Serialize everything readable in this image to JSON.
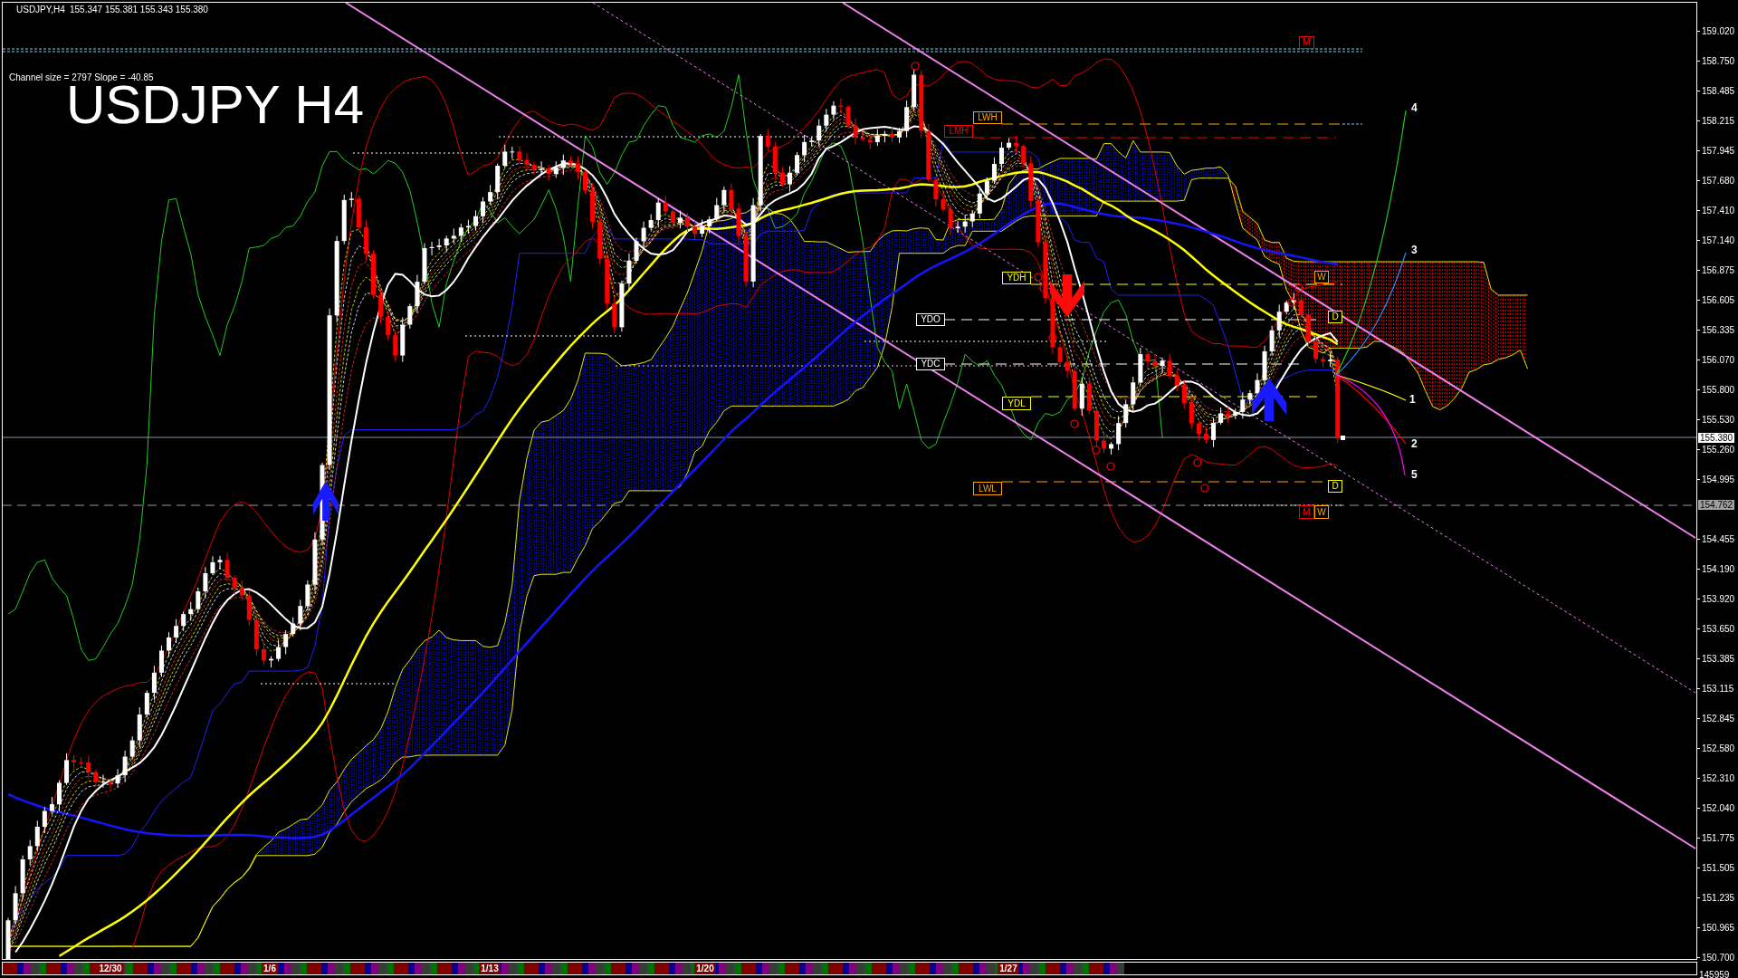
{
  "header": {
    "symbol": "USDJPY,H4",
    "ohlc": "155.347 155.381 155.343 155.380"
  },
  "channel_info": "Channel size = 2797 Slope = -40.85",
  "title": "USDJPY H4",
  "level_labels": [
    {
      "label": "M",
      "color": "#ff0000"
    },
    {
      "label": "LWH",
      "color": "#ffa500"
    },
    {
      "label": "LMH",
      "color": "#ff0000"
    },
    {
      "label": "YDH",
      "color": "#ffff00"
    },
    {
      "label": "W",
      "color": "#ffa500"
    },
    {
      "label": "YDO",
      "color": "#ffffff"
    },
    {
      "label": "D",
      "color": "#ffff00"
    },
    {
      "label": "YDC",
      "color": "#ffffff"
    },
    {
      "label": "YDL",
      "color": "#ffff00"
    },
    {
      "label": "LWL",
      "color": "#ffa500"
    },
    {
      "label": "D",
      "color": "#ffff00"
    },
    {
      "label": "M",
      "color": "#ff0000"
    },
    {
      "label": "W",
      "color": "#ffa500"
    }
  ],
  "projections": [
    {
      "label": "4",
      "color": "#22cc22"
    },
    {
      "label": "3",
      "color": "#1e90ff"
    },
    {
      "label": "1",
      "color": "#ffff00"
    },
    {
      "label": "2",
      "color": "#ff0000"
    },
    {
      "label": "5",
      "color": "#ff00ff"
    }
  ],
  "price_axis": {
    "ticks": [
      {
        "text": "159.020",
        "kind": "tick"
      },
      {
        "text": "158.750",
        "kind": "tick"
      },
      {
        "text": "158.485",
        "kind": "tick"
      },
      {
        "text": "158.215",
        "kind": "tick"
      },
      {
        "text": "157.945",
        "kind": "tick"
      },
      {
        "text": "157.680",
        "kind": "tick"
      },
      {
        "text": "157.410",
        "kind": "tick"
      },
      {
        "text": "157.140",
        "kind": "tick"
      },
      {
        "text": "156.875",
        "kind": "tick"
      },
      {
        "text": "156.605",
        "kind": "tick"
      },
      {
        "text": "156.335",
        "kind": "tick"
      },
      {
        "text": "156.070",
        "kind": "tick"
      },
      {
        "text": "155.800",
        "kind": "tick"
      },
      {
        "text": "155.530",
        "kind": "tick"
      },
      {
        "text": "155.260",
        "kind": "tick"
      },
      {
        "text": "154.995",
        "kind": "tick"
      },
      {
        "text": "154.762",
        "kind": "marker"
      },
      {
        "text": "154.455",
        "kind": "tick"
      },
      {
        "text": "154.190",
        "kind": "tick"
      },
      {
        "text": "153.920",
        "kind": "tick"
      },
      {
        "text": "153.650",
        "kind": "tick"
      },
      {
        "text": "153.385",
        "kind": "tick"
      },
      {
        "text": "153.115",
        "kind": "tick"
      },
      {
        "text": "152.845",
        "kind": "tick"
      },
      {
        "text": "152.580",
        "kind": "tick"
      },
      {
        "text": "152.310",
        "kind": "tick"
      },
      {
        "text": "152.040",
        "kind": "tick"
      },
      {
        "text": "151.775",
        "kind": "tick"
      },
      {
        "text": "151.505",
        "kind": "tick"
      },
      {
        "text": "151.235",
        "kind": "tick"
      },
      {
        "text": "150.965",
        "kind": "tick"
      },
      {
        "text": "150.700",
        "kind": "tick"
      }
    ],
    "bid": "155.380"
  },
  "time_axis": {
    "labels": [
      "12/30",
      "1/6",
      "1/13",
      "1/20",
      "1/27"
    ]
  },
  "corner_label": "145959"
}
